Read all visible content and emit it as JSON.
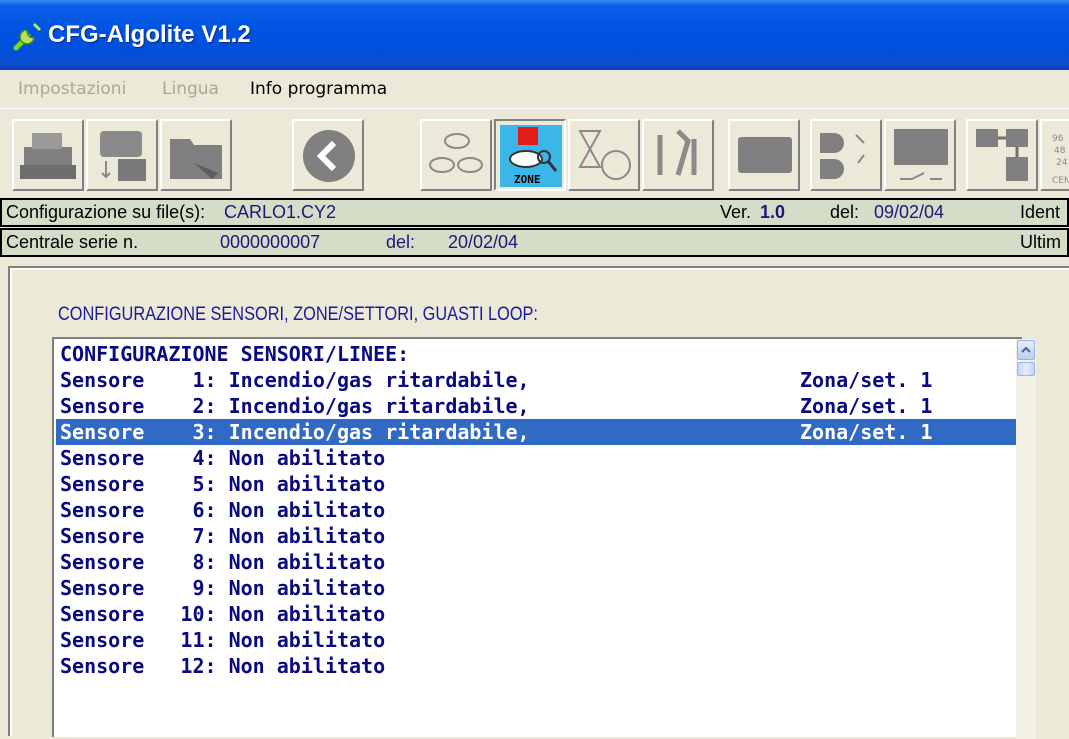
{
  "window": {
    "title": "CFG-Algolite V1.2",
    "icon": "wrench-icon"
  },
  "menu": [
    {
      "label": "Impostazioni",
      "state": "disabled"
    },
    {
      "label": "Lingua",
      "state": "disabled"
    },
    {
      "label": "Info programma",
      "state": "active"
    }
  ],
  "toolbar": {
    "buttons": [
      {
        "icon": "printer-icon"
      },
      {
        "icon": "connect-icon"
      },
      {
        "icon": "folder-icon"
      },
      {
        "icon": "back-arrow-icon"
      },
      {
        "icon": "sensors-icon"
      },
      {
        "icon": "zone-icon",
        "label": "ZONE",
        "active": true
      },
      {
        "icon": "timer-icon"
      },
      {
        "icon": "tools-icon"
      },
      {
        "icon": "blank-icon"
      },
      {
        "icon": "logic-icon"
      },
      {
        "icon": "relay-icon"
      },
      {
        "icon": "network-icon"
      },
      {
        "icon": "baud-icon"
      }
    ]
  },
  "info": {
    "config_label": "Configurazione su file(s):",
    "config_file": "CARLO1.CY2",
    "ver_label": "Ver.",
    "ver_value": "1.0",
    "del_label": "del:",
    "del_value": "09/02/04",
    "ident_label": "Ident",
    "central_label": "Centrale serie n.",
    "central_serial": "0000000007",
    "central_del_label": "del:",
    "central_del_value": "20/02/04",
    "last_label": "Ultim"
  },
  "section": {
    "title": "CONFIGURAZIONE SENSORI, ZONE/SETTORI, GUASTI LOOP:"
  },
  "list": {
    "header": "CONFIGURAZIONE SENSORI/LINEE:",
    "selected_index": 2,
    "rows": [
      {
        "text": "Sensore    1: Incendio/gas ritardabile,",
        "zone": "Zona/set. 1"
      },
      {
        "text": "Sensore    2: Incendio/gas ritardabile,",
        "zone": "Zona/set. 1"
      },
      {
        "text": "Sensore    3: Incendio/gas ritardabile,",
        "zone": "Zona/set. 1"
      },
      {
        "text": "Sensore    4: Non abilitato",
        "zone": ""
      },
      {
        "text": "Sensore    5: Non abilitato",
        "zone": ""
      },
      {
        "text": "Sensore    6: Non abilitato",
        "zone": ""
      },
      {
        "text": "Sensore    7: Non abilitato",
        "zone": ""
      },
      {
        "text": "Sensore    8: Non abilitato",
        "zone": ""
      },
      {
        "text": "Sensore    9: Non abilitato",
        "zone": ""
      },
      {
        "text": "Sensore   10: Non abilitato",
        "zone": ""
      },
      {
        "text": "Sensore   11: Non abilitato",
        "zone": ""
      },
      {
        "text": "Sensore   12: Non abilitato",
        "zone": ""
      }
    ]
  },
  "colors": {
    "titlebar": "#0054e3",
    "selection": "#316ac5",
    "list_text": "#0a0a80",
    "info_bg": "#d5dcc7"
  }
}
